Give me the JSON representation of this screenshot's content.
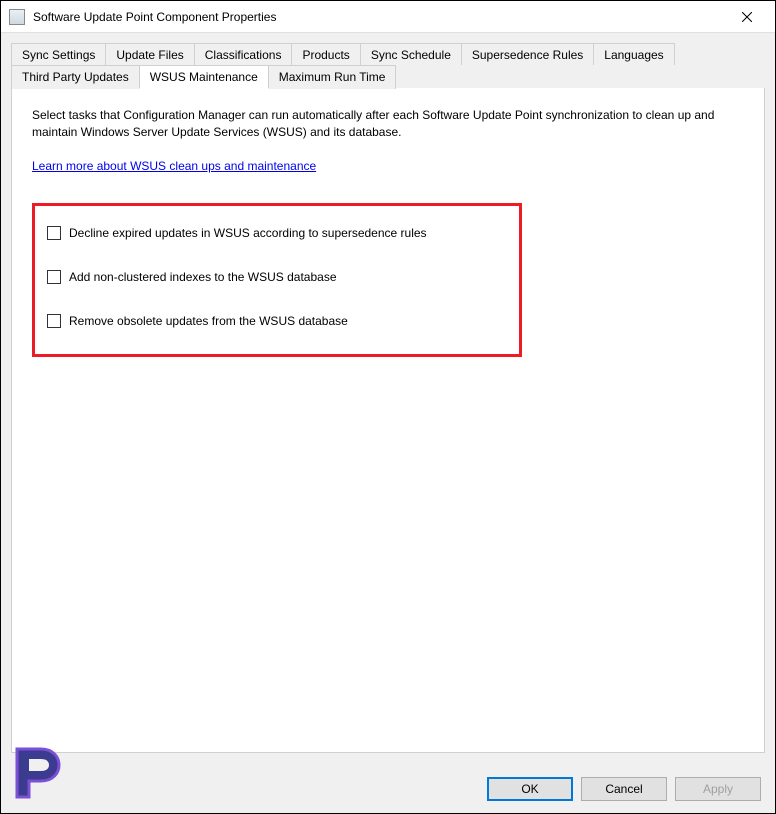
{
  "window": {
    "title": "Software Update Point Component Properties"
  },
  "tabs": {
    "row1": [
      {
        "label": "Sync Settings"
      },
      {
        "label": "Update Files"
      },
      {
        "label": "Classifications"
      },
      {
        "label": "Products"
      },
      {
        "label": "Sync Schedule"
      },
      {
        "label": "Supersedence Rules"
      },
      {
        "label": "Languages"
      }
    ],
    "row2": [
      {
        "label": "Third Party Updates"
      },
      {
        "label": "WSUS Maintenance"
      },
      {
        "label": "Maximum Run Time"
      }
    ],
    "active": "WSUS Maintenance"
  },
  "content": {
    "description": "Select tasks that Configuration Manager can run automatically after each Software Update Point synchronization to clean up and maintain Windows Server Update Services (WSUS) and its database.",
    "link_text": "Learn more about WSUS clean ups and maintenance",
    "checkboxes": [
      {
        "label": "Decline expired updates in WSUS according to supersedence rules",
        "checked": false
      },
      {
        "label": "Add non-clustered indexes to the WSUS database",
        "checked": false
      },
      {
        "label": "Remove obsolete updates from the WSUS database",
        "checked": false
      }
    ]
  },
  "buttons": {
    "ok": "OK",
    "cancel": "Cancel",
    "apply": "Apply"
  }
}
